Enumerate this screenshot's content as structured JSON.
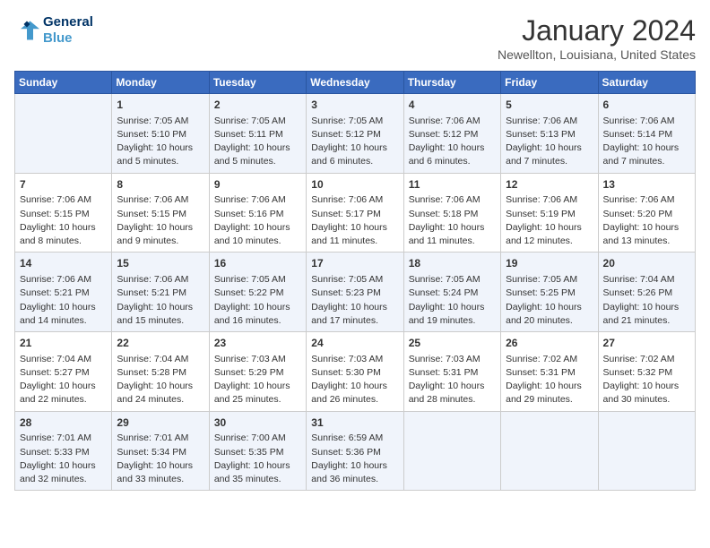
{
  "header": {
    "logo_line1": "General",
    "logo_line2": "Blue",
    "title": "January 2024",
    "subtitle": "Newellton, Louisiana, United States"
  },
  "days_of_week": [
    "Sunday",
    "Monday",
    "Tuesday",
    "Wednesday",
    "Thursday",
    "Friday",
    "Saturday"
  ],
  "weeks": [
    [
      {
        "day": "",
        "info": ""
      },
      {
        "day": "1",
        "info": "Sunrise: 7:05 AM\nSunset: 5:10 PM\nDaylight: 10 hours\nand 5 minutes."
      },
      {
        "day": "2",
        "info": "Sunrise: 7:05 AM\nSunset: 5:11 PM\nDaylight: 10 hours\nand 5 minutes."
      },
      {
        "day": "3",
        "info": "Sunrise: 7:05 AM\nSunset: 5:12 PM\nDaylight: 10 hours\nand 6 minutes."
      },
      {
        "day": "4",
        "info": "Sunrise: 7:06 AM\nSunset: 5:12 PM\nDaylight: 10 hours\nand 6 minutes."
      },
      {
        "day": "5",
        "info": "Sunrise: 7:06 AM\nSunset: 5:13 PM\nDaylight: 10 hours\nand 7 minutes."
      },
      {
        "day": "6",
        "info": "Sunrise: 7:06 AM\nSunset: 5:14 PM\nDaylight: 10 hours\nand 7 minutes."
      }
    ],
    [
      {
        "day": "7",
        "info": "Sunrise: 7:06 AM\nSunset: 5:15 PM\nDaylight: 10 hours\nand 8 minutes."
      },
      {
        "day": "8",
        "info": "Sunrise: 7:06 AM\nSunset: 5:15 PM\nDaylight: 10 hours\nand 9 minutes."
      },
      {
        "day": "9",
        "info": "Sunrise: 7:06 AM\nSunset: 5:16 PM\nDaylight: 10 hours\nand 10 minutes."
      },
      {
        "day": "10",
        "info": "Sunrise: 7:06 AM\nSunset: 5:17 PM\nDaylight: 10 hours\nand 11 minutes."
      },
      {
        "day": "11",
        "info": "Sunrise: 7:06 AM\nSunset: 5:18 PM\nDaylight: 10 hours\nand 11 minutes."
      },
      {
        "day": "12",
        "info": "Sunrise: 7:06 AM\nSunset: 5:19 PM\nDaylight: 10 hours\nand 12 minutes."
      },
      {
        "day": "13",
        "info": "Sunrise: 7:06 AM\nSunset: 5:20 PM\nDaylight: 10 hours\nand 13 minutes."
      }
    ],
    [
      {
        "day": "14",
        "info": "Sunrise: 7:06 AM\nSunset: 5:21 PM\nDaylight: 10 hours\nand 14 minutes."
      },
      {
        "day": "15",
        "info": "Sunrise: 7:06 AM\nSunset: 5:21 PM\nDaylight: 10 hours\nand 15 minutes."
      },
      {
        "day": "16",
        "info": "Sunrise: 7:05 AM\nSunset: 5:22 PM\nDaylight: 10 hours\nand 16 minutes."
      },
      {
        "day": "17",
        "info": "Sunrise: 7:05 AM\nSunset: 5:23 PM\nDaylight: 10 hours\nand 17 minutes."
      },
      {
        "day": "18",
        "info": "Sunrise: 7:05 AM\nSunset: 5:24 PM\nDaylight: 10 hours\nand 19 minutes."
      },
      {
        "day": "19",
        "info": "Sunrise: 7:05 AM\nSunset: 5:25 PM\nDaylight: 10 hours\nand 20 minutes."
      },
      {
        "day": "20",
        "info": "Sunrise: 7:04 AM\nSunset: 5:26 PM\nDaylight: 10 hours\nand 21 minutes."
      }
    ],
    [
      {
        "day": "21",
        "info": "Sunrise: 7:04 AM\nSunset: 5:27 PM\nDaylight: 10 hours\nand 22 minutes."
      },
      {
        "day": "22",
        "info": "Sunrise: 7:04 AM\nSunset: 5:28 PM\nDaylight: 10 hours\nand 24 minutes."
      },
      {
        "day": "23",
        "info": "Sunrise: 7:03 AM\nSunset: 5:29 PM\nDaylight: 10 hours\nand 25 minutes."
      },
      {
        "day": "24",
        "info": "Sunrise: 7:03 AM\nSunset: 5:30 PM\nDaylight: 10 hours\nand 26 minutes."
      },
      {
        "day": "25",
        "info": "Sunrise: 7:03 AM\nSunset: 5:31 PM\nDaylight: 10 hours\nand 28 minutes."
      },
      {
        "day": "26",
        "info": "Sunrise: 7:02 AM\nSunset: 5:31 PM\nDaylight: 10 hours\nand 29 minutes."
      },
      {
        "day": "27",
        "info": "Sunrise: 7:02 AM\nSunset: 5:32 PM\nDaylight: 10 hours\nand 30 minutes."
      }
    ],
    [
      {
        "day": "28",
        "info": "Sunrise: 7:01 AM\nSunset: 5:33 PM\nDaylight: 10 hours\nand 32 minutes."
      },
      {
        "day": "29",
        "info": "Sunrise: 7:01 AM\nSunset: 5:34 PM\nDaylight: 10 hours\nand 33 minutes."
      },
      {
        "day": "30",
        "info": "Sunrise: 7:00 AM\nSunset: 5:35 PM\nDaylight: 10 hours\nand 35 minutes."
      },
      {
        "day": "31",
        "info": "Sunrise: 6:59 AM\nSunset: 5:36 PM\nDaylight: 10 hours\nand 36 minutes."
      },
      {
        "day": "",
        "info": ""
      },
      {
        "day": "",
        "info": ""
      },
      {
        "day": "",
        "info": ""
      }
    ]
  ]
}
